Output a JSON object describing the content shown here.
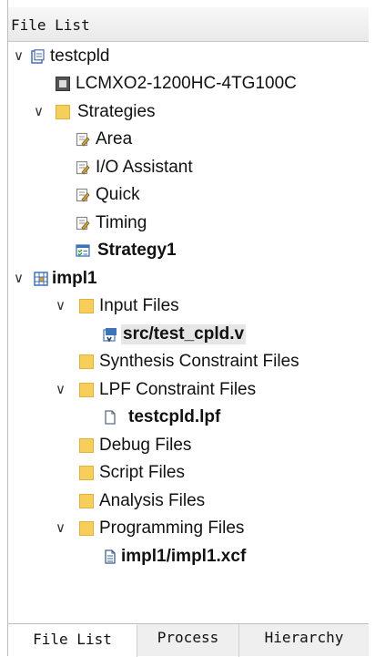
{
  "panel": {
    "title": "File List"
  },
  "tree": {
    "project": "testcpld",
    "device": "LCMXO2-1200HC-4TG100C",
    "strategies": {
      "label": "Strategies",
      "items": [
        "Area",
        "I/O Assistant",
        "Quick",
        "Timing",
        "Strategy1"
      ]
    },
    "impl": {
      "label": "impl1",
      "input_files": {
        "label": "Input Files",
        "file": "src/test_cpld.v"
      },
      "synthesis": "Synthesis Constraint Files",
      "lpf": {
        "label": "LPF Constraint Files",
        "file": "testcpld.lpf"
      },
      "debug": "Debug Files",
      "script": "Script Files",
      "analysis": "Analysis Files",
      "programming": {
        "label": "Programming Files",
        "file": "impl1/impl1.xcf"
      }
    }
  },
  "tabs": [
    "File List",
    "Process",
    "Hierarchy"
  ],
  "colors": {
    "folder": "#f6cf5a",
    "selection": "#e6e6e6",
    "chevron": "#333333"
  },
  "icons": {
    "expand": "chevron-down-icon",
    "project": "project-icon",
    "device": "chip-icon",
    "folder": "folder-icon",
    "strategy": "strategy-icon",
    "impl": "implementation-icon",
    "verilog": "verilog-file-icon",
    "file": "file-icon"
  }
}
